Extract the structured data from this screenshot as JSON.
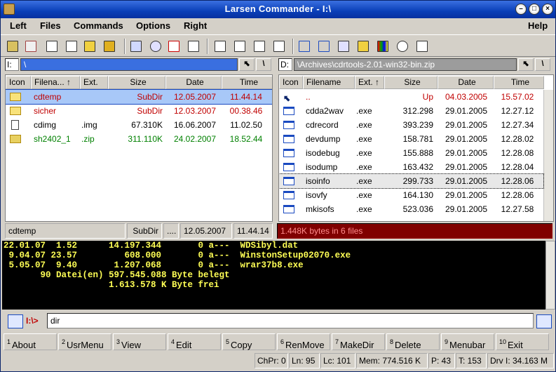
{
  "window": {
    "title": "Larsen Commander - I:\\"
  },
  "menu": [
    "Left",
    "Files",
    "Commands",
    "Options",
    "Right",
    "Help"
  ],
  "toolbar_icons": [
    "back-icon",
    "edit-icon",
    "copy-icon",
    "list-icon",
    "new-folder-icon",
    "delete-icon",
    "sync-icon",
    "refresh-icon",
    "target-icon",
    "folder-star-icon",
    "folder-icon",
    "view1-icon",
    "view2-icon",
    "view3-icon",
    "info-icon",
    "split-icon",
    "join-icon",
    "sort-icon",
    "folder-open-icon",
    "palette-icon",
    "search-icon",
    "rename-icon"
  ],
  "left": {
    "drive": "I:",
    "path": "\\",
    "columns": [
      "Icon",
      "Filena...",
      "↑",
      "Ext.",
      "Size",
      "Date",
      "Time"
    ],
    "rows": [
      {
        "icon": "folder",
        "name": "cdtemp",
        "ext": "",
        "size": "SubDir",
        "date": "12.05.2007",
        "time": "11.44.14",
        "color": "#c00000",
        "selected": true
      },
      {
        "icon": "folder",
        "name": "sicher",
        "ext": "",
        "size": "SubDir",
        "date": "12.03.2007",
        "time": "00.38.46",
        "color": "#c00000"
      },
      {
        "icon": "doc",
        "name": "cdimg",
        "ext": ".img",
        "size": "67.310K",
        "date": "16.06.2007",
        "time": "11.02.50",
        "color": "#000000"
      },
      {
        "icon": "zip",
        "name": "sh2402_1",
        "ext": ".zip",
        "size": "311.110K",
        "date": "24.02.2007",
        "time": "18.52.44",
        "color": "#008000"
      }
    ],
    "status": {
      "name": "cdtemp",
      "size": "SubDir",
      "ext": "....",
      "date": "12.05.2007",
      "time": "11.44.14"
    }
  },
  "right": {
    "drive": "D:",
    "path": "\\Archives\\cdrtools-2.01-win32-bin.zip",
    "columns": [
      "Icon",
      "Filename",
      "Ext. ↑",
      "Size",
      "Date",
      "Time"
    ],
    "rows": [
      {
        "icon": "up",
        "name": "..",
        "ext": "",
        "size": "Up",
        "date": "04.03.2005",
        "time": "15.57.02",
        "color": "#c00000"
      },
      {
        "icon": "exe",
        "name": "cdda2wav",
        "ext": ".exe",
        "size": "312.298",
        "date": "29.01.2005",
        "time": "12.27.12",
        "color": "#000000"
      },
      {
        "icon": "exe",
        "name": "cdrecord",
        "ext": ".exe",
        "size": "393.239",
        "date": "29.01.2005",
        "time": "12.27.34",
        "color": "#000000"
      },
      {
        "icon": "exe",
        "name": "devdump",
        "ext": ".exe",
        "size": "158.781",
        "date": "29.01.2005",
        "time": "12.28.02",
        "color": "#000000"
      },
      {
        "icon": "exe",
        "name": "isodebug",
        "ext": ".exe",
        "size": "155.888",
        "date": "29.01.2005",
        "time": "12.28.08",
        "color": "#000000"
      },
      {
        "icon": "exe",
        "name": "isodump",
        "ext": ".exe",
        "size": "163.432",
        "date": "29.01.2005",
        "time": "12.28.04",
        "color": "#000000"
      },
      {
        "icon": "exe",
        "name": "isoinfo",
        "ext": ".exe",
        "size": "299.733",
        "date": "29.01.2005",
        "time": "12.28.06",
        "color": "#000000",
        "focused": true
      },
      {
        "icon": "exe",
        "name": "isovfy",
        "ext": ".exe",
        "size": "164.130",
        "date": "29.01.2005",
        "time": "12.28.06",
        "color": "#000000"
      },
      {
        "icon": "exe",
        "name": "mkisofs",
        "ext": ".exe",
        "size": "523.036",
        "date": "29.01.2005",
        "time": "12.27.58",
        "color": "#000000"
      }
    ],
    "status": "1.448K bytes in 6 files"
  },
  "console": [
    "22.01.07  1.52      14.197.344       0 a---  WDSibyl.dat",
    " 9.04.07 23.57         608.000       0 a---  WinstonSetup02070.exe",
    " 5.05.07  9.40       1.207.068       0 a---  wrar37b8.exe",
    "       90 Datei(en) 597.545.088 Byte belegt",
    "                    1.613.578 K Byte frei"
  ],
  "command": {
    "prompt": "I:\\>",
    "value": "dir"
  },
  "fkeys": [
    {
      "n": "1",
      "label": "About"
    },
    {
      "n": "2",
      "label": "UsrMenu"
    },
    {
      "n": "3",
      "label": "View"
    },
    {
      "n": "4",
      "label": "Edit"
    },
    {
      "n": "5",
      "label": "Copy"
    },
    {
      "n": "6",
      "label": "RenMove"
    },
    {
      "n": "7",
      "label": "MakeDir"
    },
    {
      "n": "8",
      "label": "Delete"
    },
    {
      "n": "9",
      "label": "Menubar"
    },
    {
      "n": "10",
      "label": "Exit"
    }
  ],
  "statusbar": [
    "ChPr: 0",
    "Ln: 95",
    "Lc: 101",
    "Mem: 774.516 K",
    "P: 43",
    "T: 153",
    "Drv I: 34.163 M"
  ]
}
